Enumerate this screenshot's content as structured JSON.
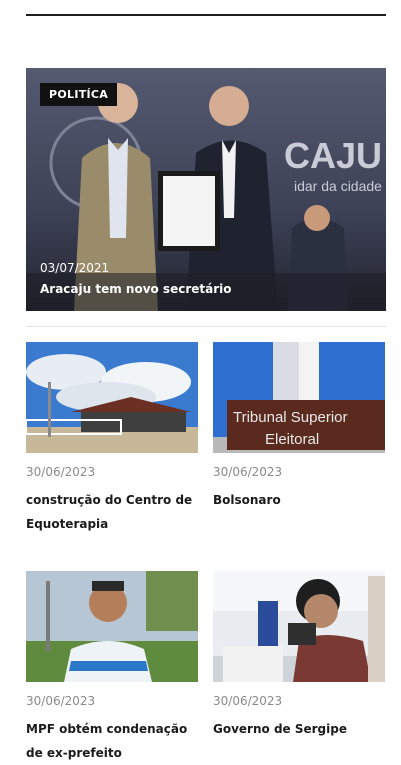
{
  "hero": {
    "category": "POLITÍCA",
    "date": "03/07/2021",
    "title": "Aracaju tem novo secretário",
    "backdrop_text": "CAJU",
    "backdrop_subtext": "idar da cidade"
  },
  "articles": [
    {
      "date": "30/06/2023",
      "title": "construção do Centro de Equoterapia"
    },
    {
      "date": "30/06/2023",
      "title": "Bolsonaro",
      "image_text_line1": "Tribunal Superior",
      "image_text_line2": "Eleitoral"
    },
    {
      "date": "30/06/2023",
      "title": "MPF obtém condenação de ex-prefeito"
    },
    {
      "date": "30/06/2023",
      "title": "Governo de Sergipe"
    }
  ],
  "colors": {
    "hero_backdrop": "#3c3f52",
    "tse_board": "#5a2a1e",
    "sky": "#3a7bd0"
  }
}
